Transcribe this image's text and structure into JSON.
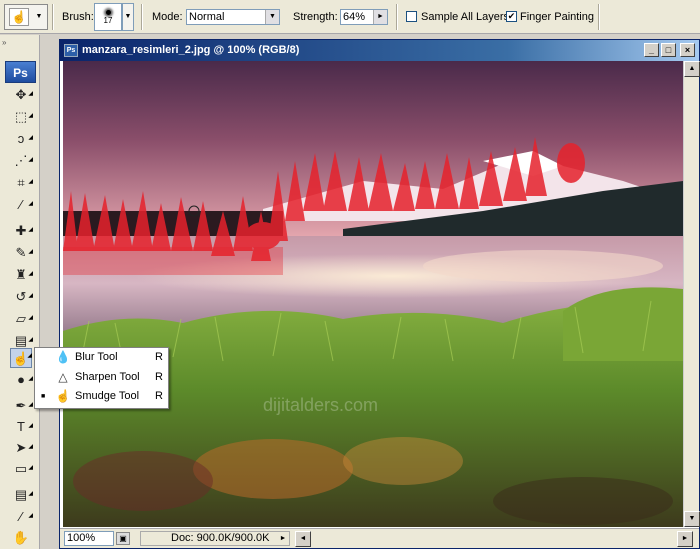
{
  "options_bar": {
    "brush_label": "Brush:",
    "brush_size": "17",
    "mode_label": "Mode:",
    "mode_value": "Normal",
    "strength_label": "Strength:",
    "strength_value": "64%",
    "sample_all_layers_label": "Sample All Layers",
    "sample_all_layers_checked": false,
    "finger_painting_label": "Finger Painting",
    "finger_painting_checked": true,
    "check_mark": "✔"
  },
  "toolbox": {
    "logo": "Ps",
    "active_tool": "smudge-tool"
  },
  "document": {
    "title": "manzara_resimleri_2.jpg @ 100% (RGB/8)",
    "zoom": "100%",
    "doc_info": "Doc: 900.0K/900.0K",
    "watermark": "dijitalders.com"
  },
  "flyout": {
    "items": [
      {
        "name": "Blur Tool",
        "key": "R",
        "icon": "blur-icon",
        "selected": false
      },
      {
        "name": "Sharpen Tool",
        "key": "R",
        "icon": "sharpen-icon",
        "selected": false
      },
      {
        "name": "Smudge Tool",
        "key": "R",
        "icon": "smudge-icon",
        "selected": true
      }
    ],
    "bullet": "■"
  },
  "colors": {
    "title_bar": "#0a246a",
    "sky_top": "#4c2a4e",
    "sky_bottom": "#e0a0a8",
    "smudge_red": "#e8202a",
    "grass": "#6f9a2e"
  }
}
